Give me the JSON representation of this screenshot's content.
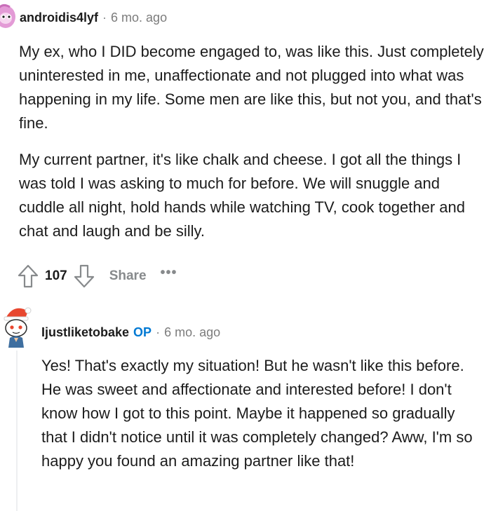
{
  "comment1": {
    "username": "androidis4lyf",
    "separator": "·",
    "timestamp": "6 mo. ago",
    "paragraphs": [
      "My ex, who I DID become engaged to, was like this. Just completely uninterested in me, unaffectionate and not plugged into what was happening in my life. Some men are like this, but not you, and that's fine.",
      "My current partner, it's like chalk and cheese. I got all the things I was told I was asking to much for before. We will snuggle and cuddle all night, hold hands while watching TV, cook together and chat and laugh and be silly."
    ],
    "score": "107",
    "share_label": "Share",
    "more_label": "•••"
  },
  "comment2": {
    "username": "Ijustliketobake",
    "op_badge": "OP",
    "separator": "·",
    "timestamp": "6 mo. ago",
    "body": "Yes! That's exactly my situation! But he wasn't like this before. He was sweet and affectionate and interested before! I don't know how I got to this point. Maybe it happened so gradually that I didn't notice until it was completely changed? Aww, I'm so happy you found an amazing partner like that!"
  },
  "colors": {
    "op_blue": "#0079d3",
    "muted": "#878a8c",
    "avatar1_pink": "#e39bd6",
    "avatar2_red": "#e8472f"
  },
  "icons": {
    "upvote": "arrow-up-outline-icon",
    "downvote": "arrow-down-outline-icon",
    "avatar1": "reddit-snoo-avatar",
    "avatar2": "reddit-snoo-avatar-santa-hat"
  }
}
